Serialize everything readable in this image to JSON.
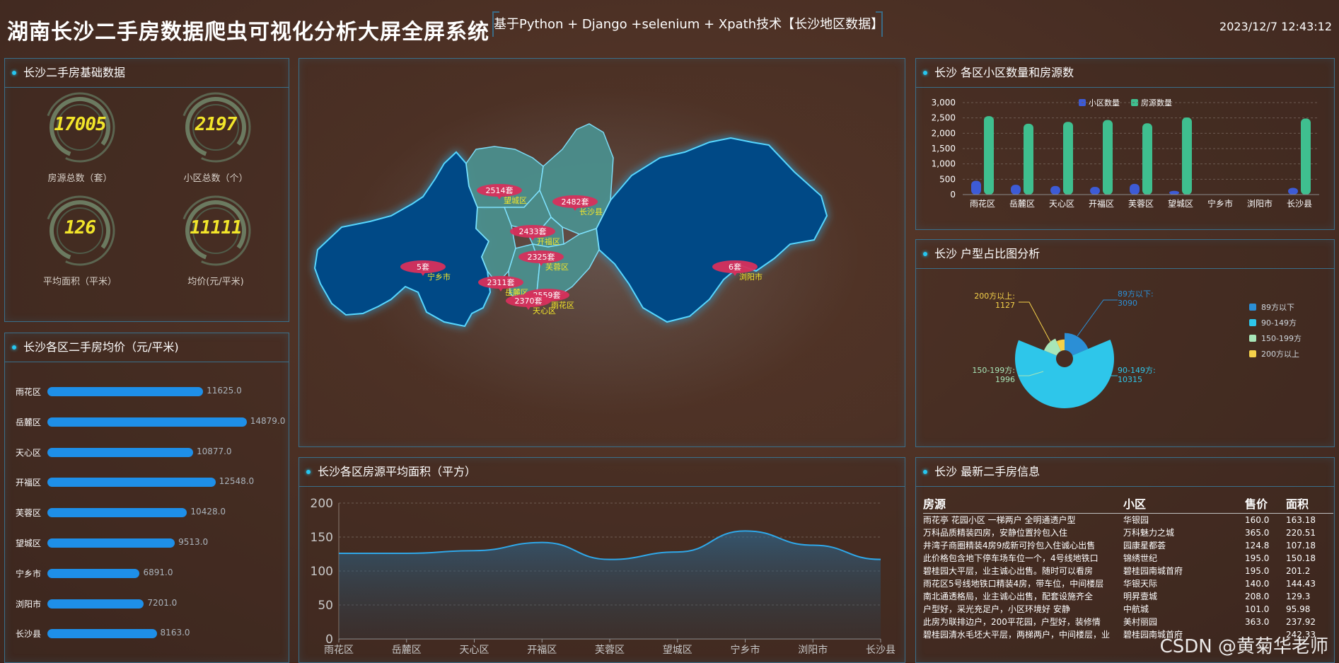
{
  "header": {
    "title": "湖南长沙二手房数据爬虫可视化分析大屏全屏系统",
    "subtitle": "基于Python + Django +selenium + Xpath技术【长沙地区数据】",
    "datetime": "2023/12/7 12:43:12"
  },
  "basic": {
    "title": "长沙二手房基础数据",
    "stats": [
      {
        "value": "17005",
        "label": "房源总数（套）"
      },
      {
        "value": "2197",
        "label": "小区总数（个）"
      },
      {
        "value": "126",
        "label": "平均面积（平米）"
      },
      {
        "value": "11111",
        "label": "均价(元/平米)"
      }
    ]
  },
  "price_chart": {
    "title": "长沙各区二手房均价（元/平米)",
    "chart_data": {
      "type": "bar",
      "orientation": "horizontal",
      "categories": [
        "雨花区",
        "岳麓区",
        "天心区",
        "开福区",
        "芙蓉区",
        "望城区",
        "宁乡市",
        "浏阳市",
        "长沙县"
      ],
      "values": [
        11625.0,
        14879.0,
        10877.0,
        12548.0,
        10428.0,
        9513.0,
        6891.0,
        7201.0,
        8163.0
      ],
      "value_labels": [
        "11625.0",
        "14879.0",
        "10877.0",
        "12548.0",
        "10428.0",
        "9513.0",
        "6891.0",
        "7201.0",
        "8163.0"
      ],
      "color": "#1e8fe8"
    }
  },
  "map": {
    "markers": [
      {
        "count": "2514套",
        "district": "望城区"
      },
      {
        "count": "2482套",
        "district": "长沙县"
      },
      {
        "count": "2433套",
        "district": "开福区"
      },
      {
        "count": "2325套",
        "district": "芙蓉区"
      },
      {
        "count": "5套",
        "district": "宁乡市"
      },
      {
        "count": "6套",
        "district": "浏阳市"
      },
      {
        "count": "2311套",
        "district": "岳麓区"
      },
      {
        "count": "2559套",
        "district": "雨花区"
      },
      {
        "count": "2370套",
        "district": "天心区"
      }
    ]
  },
  "area_chart": {
    "title": "长沙各区房源平均面积（平方）",
    "chart_data": {
      "type": "area",
      "categories": [
        "雨花区",
        "岳麓区",
        "天心区",
        "开福区",
        "芙蓉区",
        "望城区",
        "宁乡市",
        "浏阳市",
        "长沙县"
      ],
      "values": [
        126,
        126,
        130,
        142,
        117,
        128,
        159,
        138,
        117
      ],
      "yticks": [
        "0",
        "50",
        "100",
        "150",
        "200"
      ],
      "ylim": [
        0,
        200
      ]
    }
  },
  "count_chart": {
    "title": "长沙 各区小区数量和房源数",
    "chart_data": {
      "type": "bar",
      "categories": [
        "雨花区",
        "岳麓区",
        "天心区",
        "开福区",
        "芙蓉区",
        "望城区",
        "宁乡市",
        "浏阳市",
        "长沙县"
      ],
      "series": [
        {
          "name": "小区数量",
          "values": [
            450,
            320,
            280,
            250,
            350,
            120,
            0,
            0,
            220
          ],
          "color": "#3d5bd6"
        },
        {
          "name": "房源数量",
          "values": [
            2559,
            2311,
            2370,
            2433,
            2325,
            2514,
            5,
            6,
            2482
          ],
          "color": "#3fbf8f"
        }
      ],
      "yticks": [
        "0",
        "500",
        "1,000",
        "1,500",
        "2,000",
        "2,500",
        "3,000"
      ],
      "ylim": [
        0,
        3000
      ]
    }
  },
  "pie_chart": {
    "title": "长沙 户型占比图分析",
    "chart_data": {
      "type": "pie",
      "labels": [
        "89方以下",
        "90-149方",
        "150-199方",
        "200方以上"
      ],
      "values": [
        3090,
        10315,
        1996,
        1127
      ],
      "colors": [
        "#2b8fd6",
        "#2ec6ea",
        "#a8e6b8",
        "#f5d24a"
      ]
    },
    "callouts": [
      {
        "name": "89方以下:",
        "value": "3090"
      },
      {
        "name": "90-149方:",
        "value": "10315"
      },
      {
        "name": "150-199方:",
        "value": "1996"
      },
      {
        "name": "200方以上:",
        "value": "1127"
      }
    ]
  },
  "listing": {
    "title": "长沙 最新二手房信息",
    "columns": [
      "房源",
      "小区",
      "售价",
      "面积"
    ],
    "rows": [
      [
        "雨花亭 花园小区 一梯两户 全明通透户型",
        "华银园",
        "160.0",
        "163.18"
      ],
      [
        "万科品质精装四房，安静位置拎包入住",
        "万科魅力之城",
        "365.0",
        "220.51"
      ],
      [
        "井湾子商圈精装4房9成新可拎包入住诚心出售",
        "园康星都荟",
        "124.8",
        "107.18"
      ],
      [
        "此价格包含地下停车场车位一个，4号线地铁口",
        "锦绣世纪",
        "195.0",
        "150.18"
      ],
      [
        "碧桂园大平层，业主诚心出售。随时可以看房",
        "碧桂园南城首府",
        "195.0",
        "201.2"
      ],
      [
        "雨花区5号线地铁口精装4房，带车位，中间楼层",
        "华银天际",
        "140.0",
        "144.43"
      ],
      [
        "南北通透格局，业主诚心出售，配套设施齐全",
        "明昇壹城",
        "208.0",
        "129.3"
      ],
      [
        "户型好，采光充足户，小区环境好 安静",
        "中航城",
        "101.0",
        "95.98"
      ],
      [
        "此房为联排边户，200平花园，户型好，装修情",
        "美村丽园",
        "363.0",
        "237.92"
      ],
      [
        "碧桂园清水毛坯大平层，两梯两户，中间楼层，业",
        "碧桂园南城首府",
        "",
        "242.33"
      ]
    ],
    "watermark": "CSDN @黄菊华老师"
  }
}
